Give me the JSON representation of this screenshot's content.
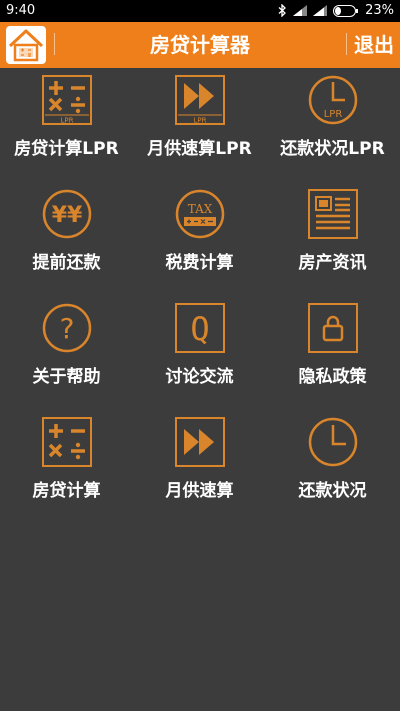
{
  "status_bar": {
    "time": "9:40",
    "battery": "23%",
    "icons": [
      "bluetooth-icon",
      "signal-icon",
      "signal-icon",
      "battery-icon"
    ]
  },
  "header": {
    "title": "房贷计算器",
    "exit_label": "退出",
    "logo_icon": "house-calculator-icon"
  },
  "colors": {
    "accent": "#ef7f1a",
    "icon": "#d9852c",
    "background": "#3c3c3c",
    "status_bar": "#000000"
  },
  "menu": [
    {
      "label": "房贷计算LPR",
      "icon": "calculator-lpr-icon"
    },
    {
      "label": "月供速算LPR",
      "icon": "fast-forward-lpr-icon"
    },
    {
      "label": "还款状况LPR",
      "icon": "clock-lpr-icon"
    },
    {
      "label": "提前还款",
      "icon": "yen-coin-icon"
    },
    {
      "label": "税费计算",
      "icon": "tax-icon"
    },
    {
      "label": "房产资讯",
      "icon": "news-icon"
    },
    {
      "label": "关于帮助",
      "icon": "question-icon"
    },
    {
      "label": "讨论交流",
      "icon": "q-chat-icon"
    },
    {
      "label": "隐私政策",
      "icon": "lock-icon"
    },
    {
      "label": "房贷计算",
      "icon": "calculator-icon"
    },
    {
      "label": "月供速算",
      "icon": "fast-forward-icon"
    },
    {
      "label": "还款状况",
      "icon": "clock-icon"
    }
  ],
  "icon_text": {
    "lpr": "LPR",
    "tax": "TAX",
    "yen": "¥¥",
    "q": "Q",
    "question": "?"
  }
}
